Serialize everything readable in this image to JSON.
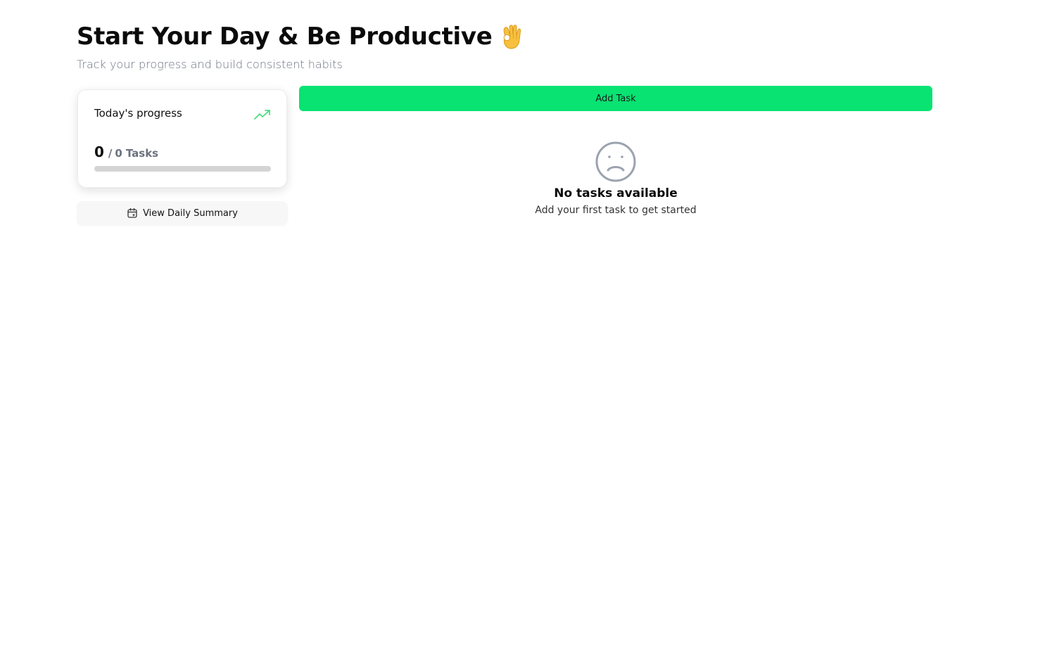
{
  "header": {
    "title": "Start Your Day & Be Productive",
    "title_icon": "ok-hand-emoji",
    "subtitle": "Track your progress and build consistent habits"
  },
  "progress_card": {
    "title": "Today's progress",
    "icon": "trending-up-icon",
    "completed": "0",
    "separator": "/",
    "total": "0",
    "unit": "Tasks",
    "progress_fraction": 0
  },
  "summary_button": {
    "icon": "calendar-icon",
    "label": "View Daily Summary"
  },
  "add_task": {
    "label": "Add Task"
  },
  "empty_state": {
    "icon": "sad-face-icon",
    "title": "No tasks available",
    "subtitle": "Add your first task to get started"
  },
  "colors": {
    "accent_green": "#08e372",
    "trend_green": "#4ade80",
    "muted_text": "#6b7280",
    "track": "#d4d4d4"
  }
}
